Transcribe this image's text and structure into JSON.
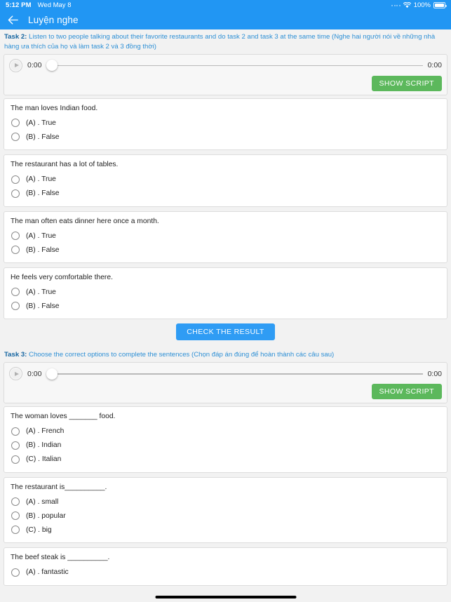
{
  "status_bar": {
    "time": "5:12 PM",
    "date": "Wed May 8",
    "battery_percent": "100%",
    "wifi_icon": "wifi-icon",
    "battery_icon": "battery-icon",
    "signal_icon": "signal-dots-icon"
  },
  "app_bar": {
    "back_icon": "back-arrow-icon",
    "title": "Luyện nghe"
  },
  "colors": {
    "accent_blue": "#2196f3",
    "task_label": "#1464a0",
    "task_text": "#2d8fd5",
    "green_button": "#5cb85c",
    "check_button": "#2f9cf4",
    "page_background": "#f2f2f2",
    "card_background": "#ffffff"
  },
  "tasks": [
    {
      "label": "Task 2:",
      "description": "Listen to two people talking about their favorite restaurants and do task 2 and task 3 at the same time (Nghe hai người nói về những nhà hàng ưa thích của họ và làm task 2 và 3 đồng thời)",
      "player": {
        "play_icon": "play-icon",
        "current_time": "0:00",
        "total_time": "0:00",
        "progress_percent": 0,
        "show_script_label": "SHOW SCRIPT"
      },
      "questions": [
        {
          "text": "The man loves Indian food.",
          "options": [
            "(A) . True",
            "(B) . False"
          ]
        },
        {
          "text": "The restaurant has a lot of tables.",
          "options": [
            "(A) . True",
            "(B) . False"
          ]
        },
        {
          "text": "The man often eats dinner here once a month.",
          "options": [
            "(A) . True",
            "(B) . False"
          ]
        },
        {
          "text": "He feels very comfortable there.",
          "options": [
            "(A) . True",
            "(B) . False"
          ]
        }
      ],
      "check_result_label": "CHECK THE RESULT"
    },
    {
      "label": "Task 3:",
      "description": "Choose the correct options to complete the sentences (Chọn đáp án đúng để hoàn thành các câu sau)",
      "player": {
        "play_icon": "play-icon",
        "current_time": "0:00",
        "total_time": "0:00",
        "progress_percent": 0,
        "show_script_label": "SHOW SCRIPT"
      },
      "questions": [
        {
          "text": "The woman loves _______ food.",
          "options": [
            "(A) . French",
            "(B) . Indian",
            "(C) . Italian"
          ]
        },
        {
          "text": "The restaurant is__________.",
          "options": [
            "(A) . small",
            "(B) . popular",
            "(C) . big"
          ]
        },
        {
          "text": "The beef steak is __________.",
          "options": [
            "(A) . fantastic"
          ]
        }
      ],
      "check_result_label": ""
    }
  ]
}
